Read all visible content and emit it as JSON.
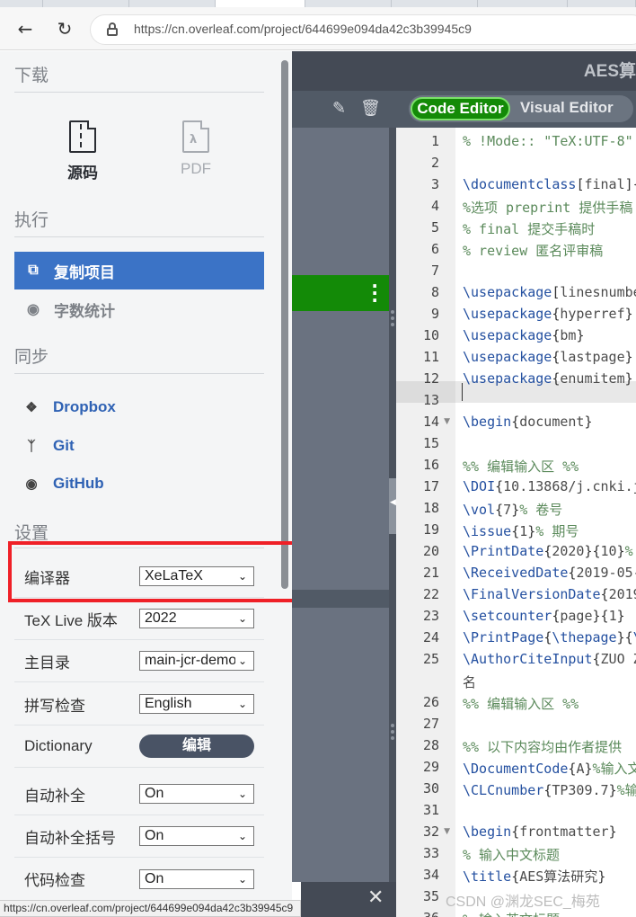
{
  "browser": {
    "tabs": [
      "",
      "",
      "",
      "",
      "",
      "",
      "",
      "",
      ""
    ],
    "back_icon": "arrow-left-icon",
    "reload_icon": "reload-icon",
    "url": "https://cn.overleaf.com/project/644699e094da42c3b39945c9"
  },
  "menu": {
    "download": {
      "title": "下载",
      "source_label": "源码",
      "pdf_label": "PDF"
    },
    "actions": {
      "title": "执行",
      "copy_project": "复制项目",
      "word_count": "字数统计"
    },
    "sync": {
      "title": "同步",
      "items": [
        {
          "label": "Dropbox",
          "icon": "dropbox-icon"
        },
        {
          "label": "Git",
          "icon": "git-icon"
        },
        {
          "label": "GitHub",
          "icon": "github-icon"
        }
      ]
    },
    "settings": {
      "title": "设置",
      "rows": [
        {
          "label": "编译器",
          "value": "XeLaTeX"
        },
        {
          "label": "TeX Live 版本",
          "value": "2022"
        },
        {
          "label": "主目录",
          "value": "main-jcr-demo"
        },
        {
          "label": "拼写检查",
          "value": "English"
        },
        {
          "label": "Dictionary",
          "button": "编辑"
        },
        {
          "label": "自动补全",
          "value": "On"
        },
        {
          "label": "自动补全括号",
          "value": "On"
        },
        {
          "label": "代码检查",
          "value": "On"
        }
      ]
    },
    "status_url": "https://cn.overleaf.com/project/644699e094da42c3b39945c9"
  },
  "editor": {
    "project_title": "AES算",
    "mode_code": "Code Editor",
    "mode_visual": "Visual Editor",
    "lines": [
      {
        "n": "1",
        "text": "% !Mode:: \"TeX:UTF-8\""
      },
      {
        "n": "2",
        "text": ""
      },
      {
        "n": "3",
        "text": "\\documentclass[final]{"
      },
      {
        "n": "4",
        "text": "%选项 preprint 提供手稿"
      },
      {
        "n": "5",
        "text": "%    final    提交手稿时"
      },
      {
        "n": "6",
        "text": "%    review   匿名评审稿"
      },
      {
        "n": "7",
        "text": ""
      },
      {
        "n": "8",
        "text": "\\usepackage[linesnumbe"
      },
      {
        "n": "9",
        "text": "\\usepackage{hyperref}"
      },
      {
        "n": "10",
        "text": "\\usepackage{bm}"
      },
      {
        "n": "11",
        "text": "\\usepackage{lastpage}"
      },
      {
        "n": "12",
        "text": "\\usepackage{enumitem}"
      },
      {
        "n": "13",
        "text": ""
      },
      {
        "n": "14",
        "text": "\\begin{document}"
      },
      {
        "n": "15",
        "text": ""
      },
      {
        "n": "16",
        "text": "%% 编辑输入区 %%"
      },
      {
        "n": "17",
        "text": "\\DOI{10.13868/j.cnki.j"
      },
      {
        "n": "18",
        "text": "\\vol{7}% 卷号"
      },
      {
        "n": "19",
        "text": "\\issue{1}% 期号"
      },
      {
        "n": "20",
        "text": "\\PrintDate{2020}{10}%"
      },
      {
        "n": "21",
        "text": "\\ReceivedDate{2019-05-"
      },
      {
        "n": "22",
        "text": "\\FinalVersionDate{2019"
      },
      {
        "n": "23",
        "text": "\\setcounter{page}{1}"
      },
      {
        "n": "24",
        "text": "\\PrintPage{\\thepage}{\\"
      },
      {
        "n": "25",
        "text": "\\AuthorCiteInput{ZUO Z"
      },
      {
        "n": "",
        "text": "名"
      },
      {
        "n": "26",
        "text": "%% 编辑输入区 %%"
      },
      {
        "n": "27",
        "text": ""
      },
      {
        "n": "28",
        "text": "%% 以下内容均由作者提供"
      },
      {
        "n": "29",
        "text": "\\DocumentCode{A}%输入文"
      },
      {
        "n": "30",
        "text": "\\CLCnumber{TP309.7}%输"
      },
      {
        "n": "31",
        "text": ""
      },
      {
        "n": "32",
        "text": "\\begin{frontmatter}"
      },
      {
        "n": "33",
        "text": "  % 输入中文标题"
      },
      {
        "n": "34",
        "text": "  \\title{AES算法研究}"
      },
      {
        "n": "35",
        "text": ""
      },
      {
        "n": "36",
        "text": "  % 输入英文标题"
      }
    ]
  },
  "watermark": "CSDN @渊龙SEC_梅苑",
  "colors": {
    "accent_blue": "#3b73c6",
    "overleaf_green": "#138a07",
    "highlight_red": "#ef2027"
  }
}
